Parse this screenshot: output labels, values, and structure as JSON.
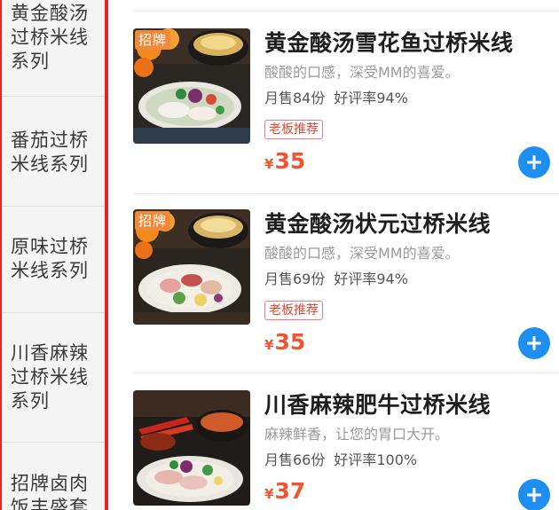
{
  "sidebar": {
    "categories": [
      {
        "line1": "黄金酸汤",
        "line2": "过桥米线",
        "line3": "系列"
      },
      {
        "line1": "番茄过桥",
        "line2": "米线系列",
        "line3": ""
      },
      {
        "line1": "原味过桥",
        "line2": "米线系列",
        "line3": ""
      },
      {
        "line1": "川香麻辣",
        "line2": "过桥米线",
        "line3": "系列"
      },
      {
        "line1": "招牌卤肉",
        "line2": "饭丰盛套",
        "line3": ""
      }
    ]
  },
  "products": [
    {
      "badge": "招牌",
      "title": "黄金酸汤雪花鱼过桥米线",
      "description": "酸酸的口感，深受MM的喜爱。",
      "monthly_sales": "月售84份",
      "rating": "好评率94%",
      "tag": "老板推荐",
      "currency": "¥",
      "price": "35",
      "add_icon": "plus-icon"
    },
    {
      "badge": "招牌",
      "title": "黄金酸汤状元过桥米线",
      "description": "酸酸的口感，深受MM的喜爱。",
      "monthly_sales": "月售69份",
      "rating": "好评率94%",
      "tag": "老板推荐",
      "currency": "¥",
      "price": "35",
      "add_icon": "plus-icon"
    },
    {
      "badge": "",
      "title": "川香麻辣肥牛过桥米线",
      "description": "麻辣鲜香，让您的胃口大开。",
      "monthly_sales": "月售66份",
      "rating": "好评率100%",
      "tag": "",
      "currency": "¥",
      "price": "37",
      "add_icon": "plus-icon"
    }
  ],
  "colors": {
    "accent_red": "#e8232a",
    "price_orange": "#f0552f",
    "badge_orange": "#f0893a",
    "add_button_blue": "#1f8ef1"
  }
}
